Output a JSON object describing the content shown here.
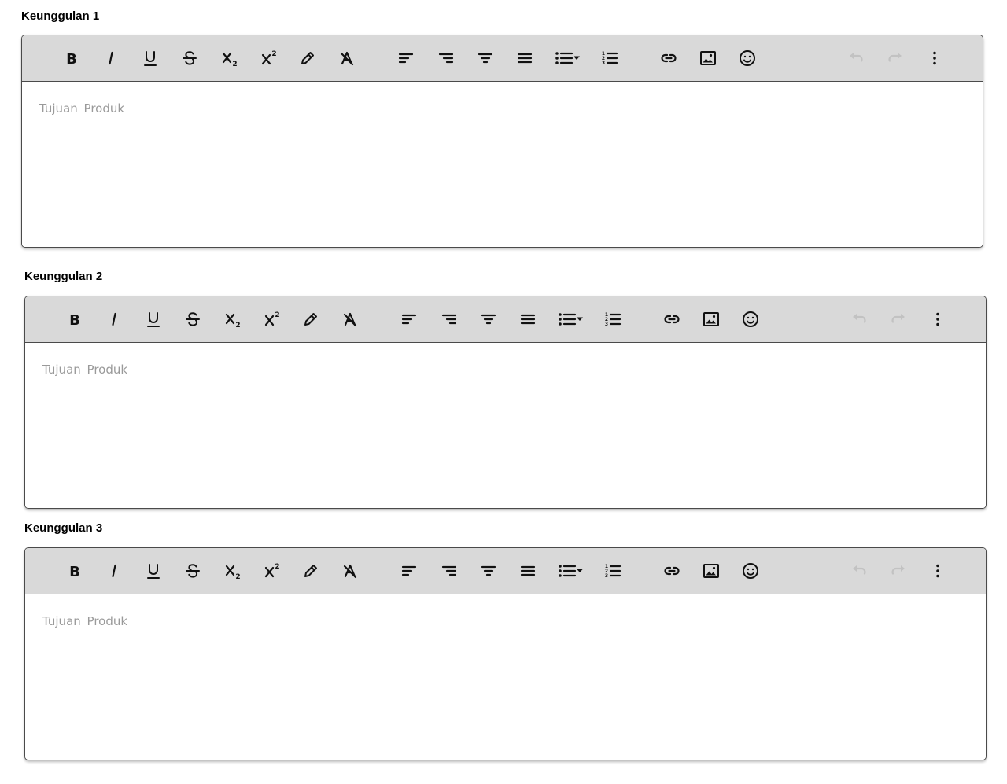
{
  "editors": [
    {
      "title": "Keunggulan 1",
      "placeholder": "Tujuan  Produk"
    },
    {
      "title": "Keunggulan 2",
      "placeholder": "Tujuan  Produk"
    },
    {
      "title": "Keunggulan 3",
      "placeholder": "Tujuan  Produk"
    }
  ],
  "toolbar_buttons": [
    {
      "name": "bold-button",
      "icon": "bold-icon",
      "disabled": false
    },
    {
      "name": "italic-button",
      "icon": "italic-icon",
      "disabled": false
    },
    {
      "name": "underline-button",
      "icon": "underline-icon",
      "disabled": false
    },
    {
      "name": "strikethrough-button",
      "icon": "strikethrough-icon",
      "disabled": false
    },
    {
      "name": "subscript-button",
      "icon": "subscript-icon",
      "disabled": false
    },
    {
      "name": "superscript-button",
      "icon": "superscript-icon",
      "disabled": false
    },
    {
      "name": "highlight-button",
      "icon": "pencil-icon",
      "disabled": false
    },
    {
      "name": "clear-formatting-button",
      "icon": "clear-formatting-icon",
      "disabled": false
    },
    {
      "name": "align-left-button",
      "icon": "align-left-icon",
      "disabled": false
    },
    {
      "name": "align-right-button",
      "icon": "align-right-icon",
      "disabled": false
    },
    {
      "name": "align-center-button",
      "icon": "align-center-icon",
      "disabled": false
    },
    {
      "name": "align-justify-button",
      "icon": "align-justify-icon",
      "disabled": false
    },
    {
      "name": "bullet-list-button",
      "icon": "bullet-list-dropdown-icon",
      "disabled": false
    },
    {
      "name": "numbered-list-button",
      "icon": "numbered-list-icon",
      "disabled": false
    },
    {
      "name": "insert-link-button",
      "icon": "link-icon",
      "disabled": false
    },
    {
      "name": "insert-image-button",
      "icon": "image-icon",
      "disabled": false
    },
    {
      "name": "insert-emoji-button",
      "icon": "emoji-icon",
      "disabled": false
    },
    {
      "name": "undo-button",
      "icon": "undo-icon",
      "disabled": true
    },
    {
      "name": "redo-button",
      "icon": "redo-icon",
      "disabled": true
    },
    {
      "name": "more-options-button",
      "icon": "more-vertical-icon",
      "disabled": false
    }
  ],
  "colors": {
    "toolbar_bg": "#d9d9d9",
    "border": "#4a4a4a",
    "placeholder_text": "#9a9a9a",
    "icon": "#111111",
    "disabled_icon": "#9a9a9a"
  }
}
